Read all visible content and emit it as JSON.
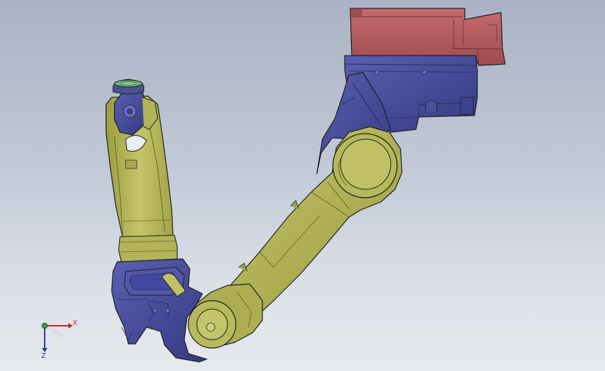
{
  "viewport": {
    "background_top": "#a9b3c5",
    "background_bottom": "#e6e9ee"
  },
  "model": {
    "colors": {
      "base_housing": "#b85f63",
      "base_housing_dark": "#8e4245",
      "joint_blue": "#4b4f9c",
      "joint_blue_dark": "#2d3070",
      "arm_olive": "#b3b457",
      "arm_olive_dark": "#7c7d2c",
      "arm_olive_light": "#c9ca72",
      "flange_green": "#6fb17a",
      "edge_line": "#1c1c1c"
    },
    "parts": [
      "base-housing",
      "turret",
      "shoulder-joint",
      "upper-arm",
      "elbow-joint",
      "elbow-housing",
      "forearm",
      "wrist",
      "tool-flange"
    ]
  },
  "triad": {
    "x_label": "X",
    "z_label": "Z",
    "x_color": "#c4262b",
    "y_color": "#2f9a3a",
    "z_color": "#2a3aa8"
  }
}
